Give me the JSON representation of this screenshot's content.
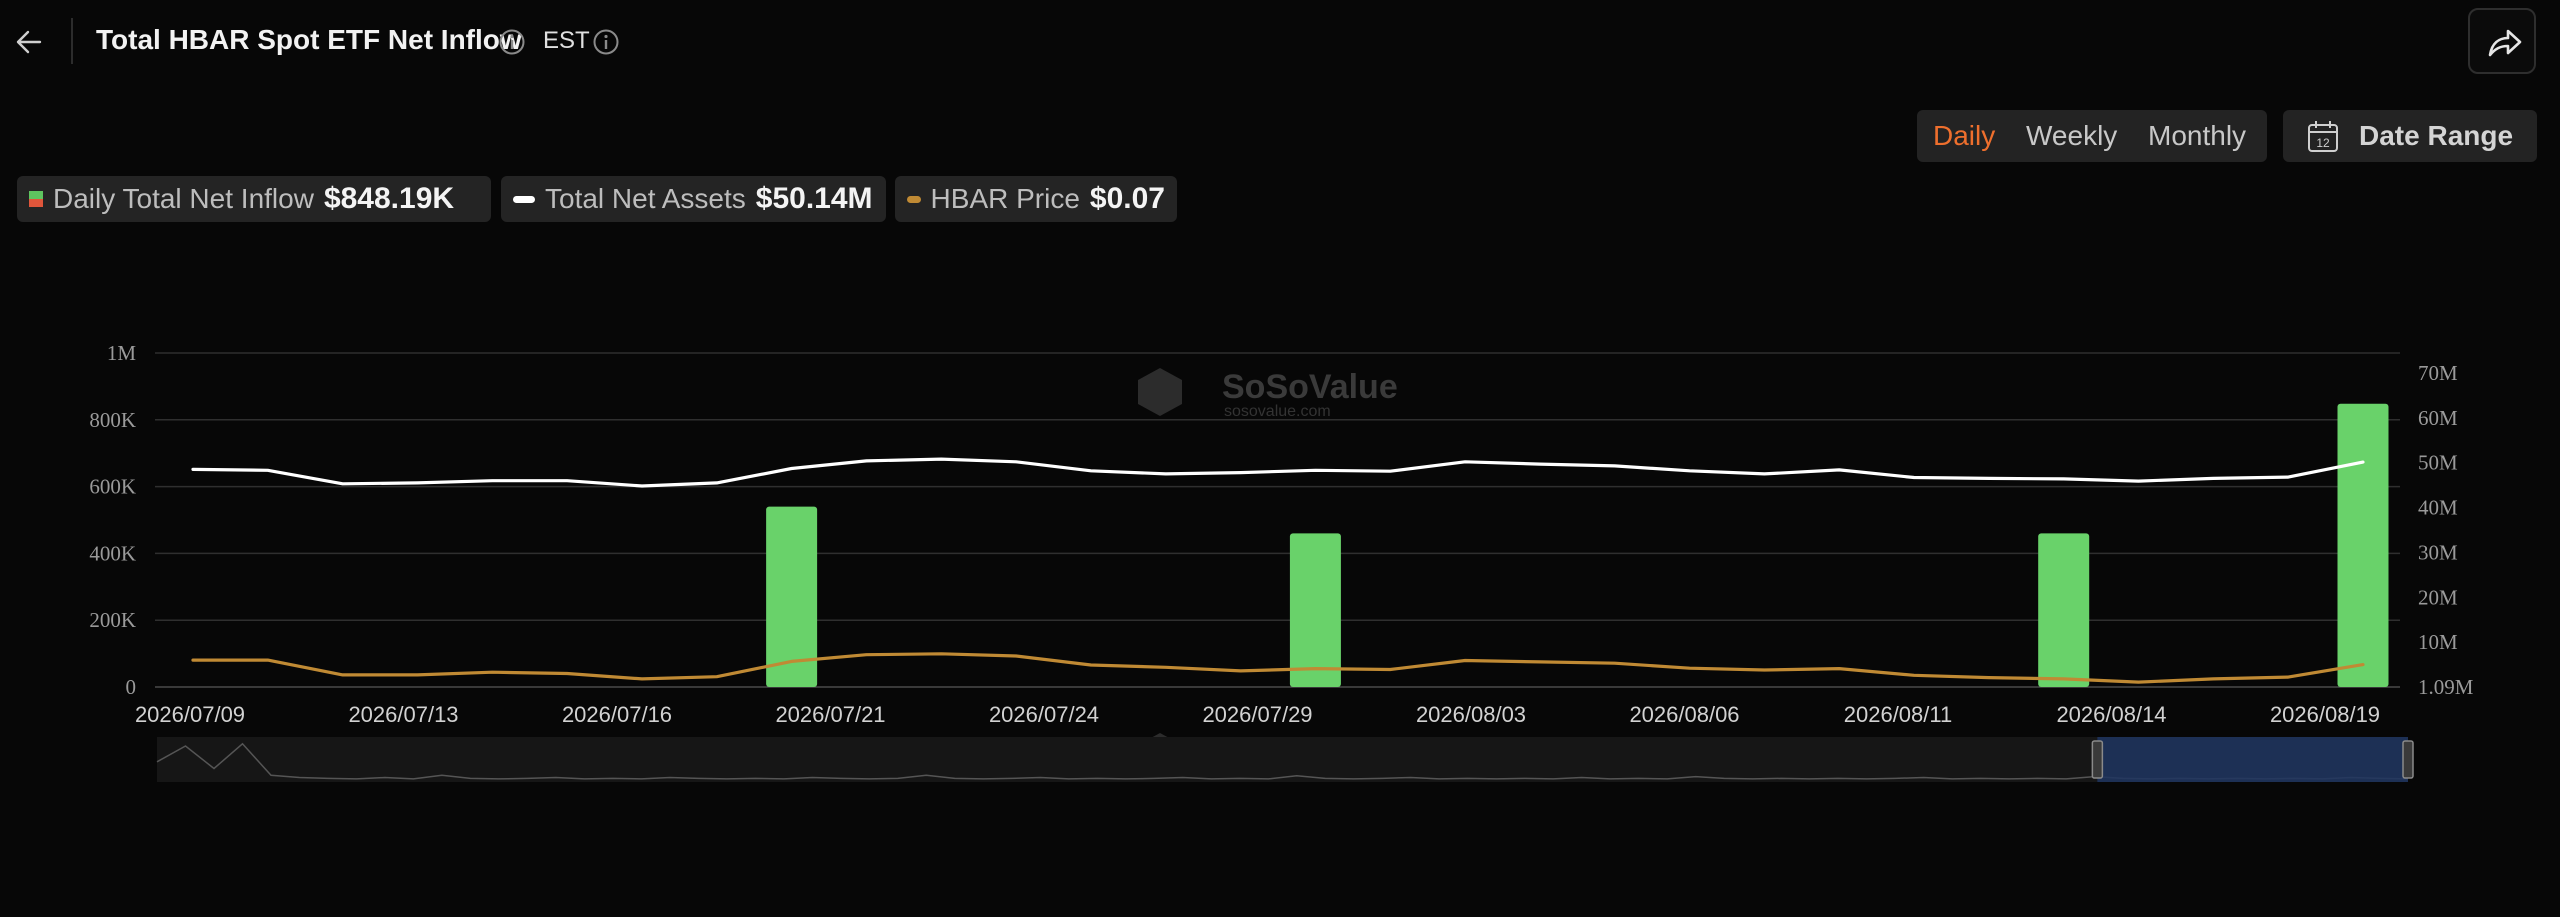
{
  "header": {
    "title": "Total HBAR Spot ETF Net Inflow",
    "timezone": "EST"
  },
  "periods": {
    "daily": "Daily",
    "weekly": "Weekly",
    "monthly": "Monthly",
    "active": "daily"
  },
  "date_range": {
    "label": "Date Range",
    "calendar_day": "12"
  },
  "legend": [
    {
      "name": "Daily Total Net Inflow",
      "value": "$848.19K"
    },
    {
      "name": "Total Net Assets",
      "value": "$50.14M"
    },
    {
      "name": "HBAR Price",
      "value": "$0.07"
    }
  ],
  "watermark": {
    "brand": "SoSoValue",
    "domain": "sosovalue.com"
  },
  "colors": {
    "accent": "#ee6f2d",
    "inflow_positive": "#69d26a",
    "inflow_negative": "#e0563b",
    "net_assets_line": "#ffffff",
    "price_line": "#c08a34",
    "brush_selection": "#1e3560"
  },
  "chart_data": {
    "type": "bar",
    "left_axis": {
      "ticks": [
        "0",
        "200K",
        "400K",
        "600K",
        "800K",
        "1M"
      ],
      "ylim": [
        0,
        1000000
      ]
    },
    "right_axis": {
      "ticks": [
        "1.09M",
        "10M",
        "20M",
        "30M",
        "40M",
        "50M",
        "60M",
        "70M"
      ],
      "ylim": [
        0,
        70000000
      ]
    },
    "x_tick_labels": [
      "2026/07/09",
      "2026/07/13",
      "2026/07/16",
      "2026/07/21",
      "2026/07/24",
      "2026/07/29",
      "2026/08/03",
      "2026/08/06",
      "2026/08/11",
      "2026/08/14",
      "2026/08/19"
    ],
    "x": [
      "2026/07/09",
      "2026/07/10",
      "2026/07/13",
      "2026/07/14",
      "2026/07/15",
      "2026/07/16",
      "2026/07/17",
      "2026/07/20",
      "2026/07/21",
      "2026/07/22",
      "2026/07/23",
      "2026/07/24",
      "2026/07/27",
      "2026/07/28",
      "2026/07/29",
      "2026/07/30",
      "2026/07/31",
      "2026/08/03",
      "2026/08/04",
      "2026/08/05",
      "2026/08/06",
      "2026/08/07",
      "2026/08/10",
      "2026/08/11",
      "2026/08/12",
      "2026/08/13",
      "2026/08/14",
      "2026/08/17",
      "2026/08/18",
      "2026/08/19"
    ],
    "series": [
      {
        "name": "Daily Total Net Inflow",
        "kind": "bar",
        "axis": "left",
        "values": [
          0,
          0,
          0,
          0,
          0,
          0,
          0,
          0,
          540000,
          0,
          0,
          0,
          0,
          0,
          0,
          460000,
          0,
          0,
          0,
          0,
          0,
          0,
          0,
          0,
          0,
          460000,
          0,
          0,
          0,
          848190
        ]
      },
      {
        "name": "Total Net Assets",
        "kind": "line",
        "axis": "right",
        "values": [
          48.5,
          48.3,
          45.3,
          45.5,
          46.0,
          46.0,
          44.8,
          45.5,
          48.7,
          50.4,
          50.8,
          50.2,
          48.2,
          47.5,
          47.8,
          48.3,
          48.1,
          50.2,
          49.7,
          49.3,
          48.2,
          47.5,
          48.4,
          46.7,
          46.5,
          46.4,
          45.9,
          46.5,
          46.8,
          50.14
        ]
      },
      {
        "name": "HBAR Price",
        "kind": "line",
        "axis": "right",
        "values": [
          6.0,
          6.0,
          2.7,
          2.7,
          3.3,
          3.0,
          1.8,
          2.3,
          5.7,
          7.2,
          7.4,
          6.9,
          4.9,
          4.4,
          3.6,
          4.1,
          3.9,
          5.9,
          5.6,
          5.3,
          4.2,
          3.8,
          4.1,
          2.6,
          2.1,
          1.8,
          1.09,
          1.8,
          2.2,
          5.0
        ]
      }
    ],
    "brush": {
      "overview": [
        0.55,
        0.2,
        0.7,
        0.15,
        0.85,
        0.9,
        0.92,
        0.93,
        0.9,
        0.93,
        0.85,
        0.92,
        0.93,
        0.92,
        0.9,
        0.93,
        0.92,
        0.93,
        0.9,
        0.92,
        0.93,
        0.92,
        0.93,
        0.9,
        0.92,
        0.93,
        0.92,
        0.85,
        0.92,
        0.93,
        0.92,
        0.9,
        0.93,
        0.92,
        0.93,
        0.92,
        0.9,
        0.93,
        0.92,
        0.93,
        0.86,
        0.92,
        0.93,
        0.92,
        0.9,
        0.93,
        0.92,
        0.93,
        0.92,
        0.93,
        0.9,
        0.93,
        0.92,
        0.93,
        0.88,
        0.92,
        0.93,
        0.92,
        0.93,
        0.92,
        0.93,
        0.92,
        0.9,
        0.93,
        0.92,
        0.93,
        0.92,
        0.93,
        0.88,
        0.92,
        0.93,
        0.92,
        0.93,
        0.92,
        0.93,
        0.92,
        0.93,
        0.9,
        0.92,
        0.93
      ],
      "selection": [
        0.862,
        1.0
      ]
    }
  }
}
